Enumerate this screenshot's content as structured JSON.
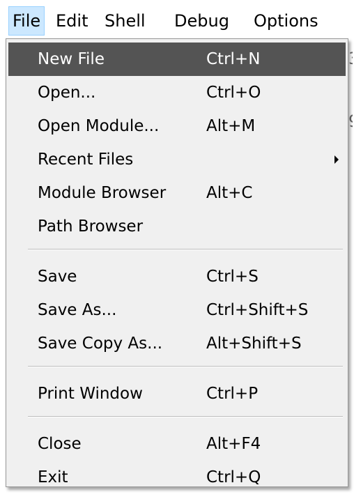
{
  "menubar": {
    "items": [
      {
        "label": "File",
        "active": true
      },
      {
        "label": "Edit"
      },
      {
        "label": "Shell"
      },
      {
        "label": "Debug"
      },
      {
        "label": "Options"
      }
    ]
  },
  "file_menu": {
    "items": [
      {
        "label": "New File",
        "shortcut": "Ctrl+N",
        "highlighted": true
      },
      {
        "label": "Open...",
        "shortcut": "Ctrl+O"
      },
      {
        "label": "Open Module...",
        "shortcut": "Alt+M"
      },
      {
        "label": "Recent Files",
        "shortcut": "",
        "submenu": true
      },
      {
        "label": "Module Browser",
        "shortcut": "Alt+C"
      },
      {
        "label": "Path Browser",
        "shortcut": ""
      },
      {
        "label": "Save",
        "shortcut": "Ctrl+S"
      },
      {
        "label": "Save As...",
        "shortcut": "Ctrl+Shift+S"
      },
      {
        "label": "Save Copy As...",
        "shortcut": "Alt+Shift+S"
      },
      {
        "label": "Print Window",
        "shortcut": "Ctrl+P"
      },
      {
        "label": "Close",
        "shortcut": "Alt+F4"
      },
      {
        "label": "Exit",
        "shortcut": "Ctrl+Q"
      }
    ]
  },
  "colors": {
    "menu_background": "#f0f0f0",
    "highlight_background": "#545454",
    "highlight_text": "#ffffff",
    "menubar_active": "#cce8ff"
  },
  "icons": {
    "submenu_indicator": "chevron-right-icon"
  }
}
